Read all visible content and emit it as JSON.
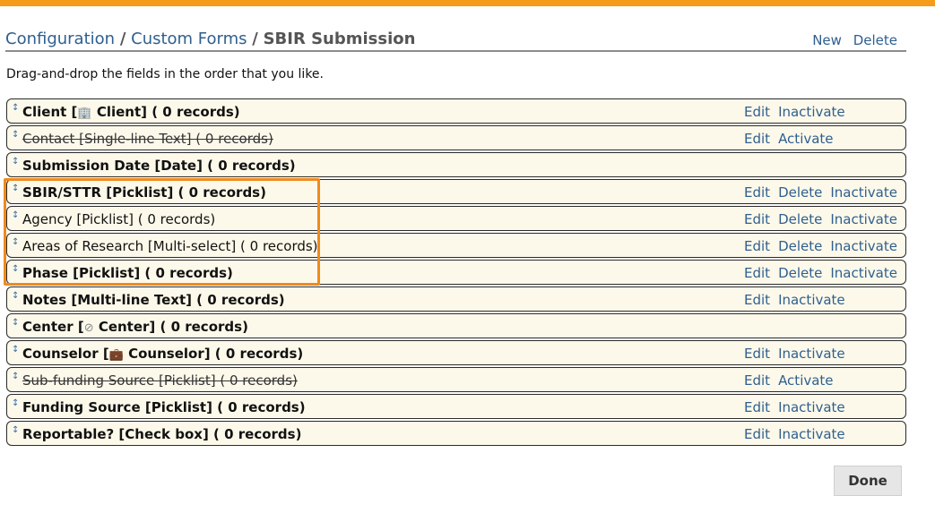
{
  "header": {
    "breadcrumbs": [
      "Configuration",
      "Custom Forms",
      "SBIR Submission"
    ],
    "separator": "/",
    "actions": [
      "New",
      "Delete"
    ]
  },
  "instructions": "Drag-and-drop the fields in the order that you like.",
  "fields": [
    {
      "pre": "Client [",
      "icon": "building-icon",
      "glyph": "🏢",
      "post": " Client] ( 0 records)",
      "bold": true,
      "strike": false,
      "actions": [
        "Edit",
        "Inactivate"
      ]
    },
    {
      "label": "Contact [Single-line Text] ( 0 records)",
      "bold": false,
      "strike": true,
      "actions": [
        "Edit",
        "Activate"
      ]
    },
    {
      "label": "Submission Date [Date] ( 0 records)",
      "bold": true,
      "strike": false,
      "actions": []
    },
    {
      "label": "SBIR/STTR [Picklist] ( 0 records)",
      "bold": true,
      "strike": false,
      "actions": [
        "Edit",
        "Delete",
        "Inactivate"
      ]
    },
    {
      "label": "Agency [Picklist] ( 0 records)",
      "bold": false,
      "strike": false,
      "actions": [
        "Edit",
        "Delete",
        "Inactivate"
      ]
    },
    {
      "label": "Areas of Research [Multi-select] ( 0 records)",
      "bold": false,
      "strike": false,
      "actions": [
        "Edit",
        "Delete",
        "Inactivate"
      ]
    },
    {
      "label": "Phase [Picklist] ( 0 records)",
      "bold": true,
      "strike": false,
      "actions": [
        "Edit",
        "Delete",
        "Inactivate"
      ]
    },
    {
      "label": "Notes [Multi-line Text] ( 0 records)",
      "bold": true,
      "strike": false,
      "actions": [
        "Edit",
        "Inactivate"
      ]
    },
    {
      "pre": "Center [",
      "icon": "compass-icon",
      "glyph": "⊘",
      "post": " Center] ( 0 records)",
      "bold": true,
      "strike": false,
      "actions": []
    },
    {
      "pre": "Counselor [",
      "icon": "briefcase-icon",
      "glyph": "💼",
      "post": " Counselor] ( 0 records)",
      "bold": true,
      "strike": false,
      "actions": [
        "Edit",
        "Inactivate"
      ]
    },
    {
      "label": "Sub-funding Source [Picklist] ( 0 records)",
      "bold": false,
      "strike": true,
      "actions": [
        "Edit",
        "Activate"
      ]
    },
    {
      "label": "Funding Source [Picklist] ( 0 records)",
      "bold": true,
      "strike": false,
      "actions": [
        "Edit",
        "Inactivate"
      ]
    },
    {
      "label": "Reportable? [Check box] ( 0 records)",
      "bold": true,
      "strike": false,
      "actions": [
        "Edit",
        "Inactivate"
      ]
    }
  ],
  "handle_glyph": "↕",
  "done_label": "Done",
  "colors": {
    "accent": "#f59c1a",
    "link": "#2f5f8f",
    "row_bg": "#fdf9ea",
    "highlight": "#f08a1c"
  }
}
